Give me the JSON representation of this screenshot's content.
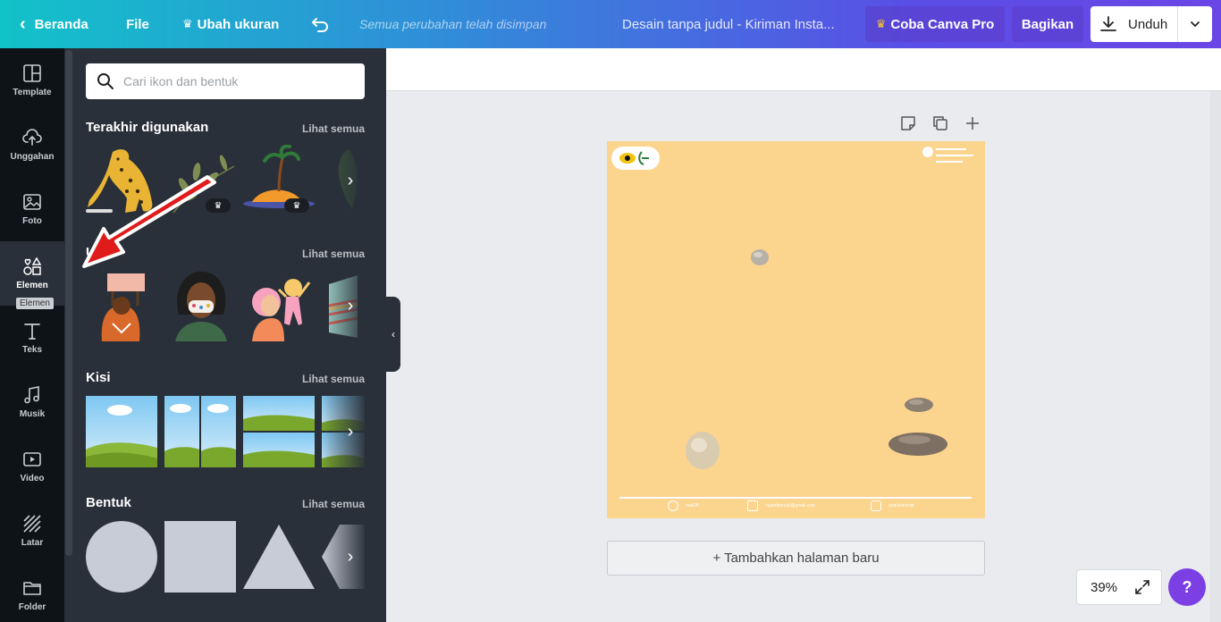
{
  "topbar": {
    "back_label": "Beranda",
    "file_label": "File",
    "resize_label": "Ubah ukuran",
    "saved_status": "Semua perubahan telah disimpan",
    "doc_title": "Desain tanpa judul - Kiriman Insta...",
    "pro_label": "Coba Canva Pro",
    "share_label": "Bagikan",
    "download_label": "Unduh"
  },
  "rail": {
    "items": [
      {
        "label": "Template",
        "icon": "template-icon"
      },
      {
        "label": "Unggahan",
        "icon": "upload-icon"
      },
      {
        "label": "Foto",
        "icon": "photo-icon"
      },
      {
        "label": "Elemen",
        "icon": "elements-icon"
      },
      {
        "label": "Teks",
        "icon": "text-icon"
      },
      {
        "label": "Musik",
        "icon": "music-icon"
      },
      {
        "label": "Video",
        "icon": "video-icon"
      },
      {
        "label": "Latar",
        "icon": "background-icon"
      },
      {
        "label": "Folder",
        "icon": "folder-icon"
      }
    ],
    "active": "Elemen",
    "tooltip": "Elemen"
  },
  "panel": {
    "search_placeholder": "Cari ikon dan bentuk",
    "sections": [
      {
        "title": "Terakhir digunakan",
        "more": "Lihat semua"
      },
      {
        "title": "U",
        "more": "Lihat semua"
      },
      {
        "title": "Kisi",
        "more": "Lihat semua"
      },
      {
        "title": "Bentuk",
        "more": "Lihat semua"
      }
    ]
  },
  "design": {
    "footer_items": [
      "mail2ff",
      "hujanfannuzi@gmail.com",
      "yuqi.kuruhab"
    ]
  },
  "canvas": {
    "add_page_label": "+ Tambahkan halaman baru",
    "zoom_level": "39%",
    "help_label": "?"
  },
  "colors": {
    "panel_bg": "#293039",
    "rail_bg": "#0e1318",
    "design_bg": "#fbd48e",
    "accent": "#7b3fe4"
  }
}
